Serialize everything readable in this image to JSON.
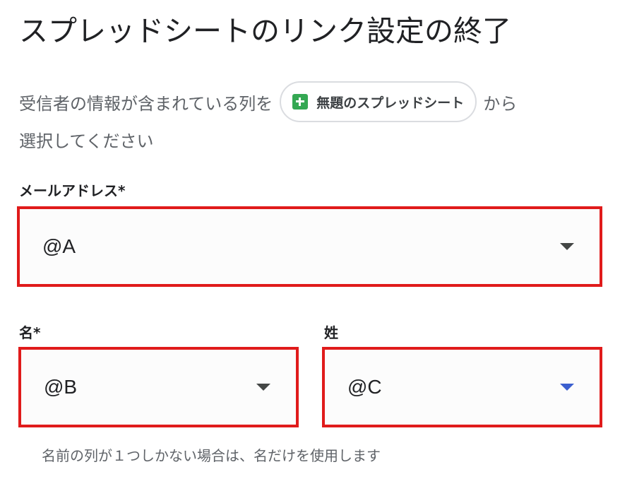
{
  "title": "スプレッドシートのリンク設定の終了",
  "intro": {
    "before_chip": "受信者の情報が含まれている列を",
    "chip_label": "無題のスプレッドシート",
    "chip_icon": "sheets-icon",
    "after_chip": "から",
    "line2": "選択してください"
  },
  "fields": {
    "email": {
      "label": "メールアドレス*",
      "value": "@A"
    },
    "first_name": {
      "label": "名*",
      "value": "@B"
    },
    "last_name": {
      "label": "姓",
      "value": "@C"
    }
  },
  "helper_text": "名前の列が１つしかない場合は、名だけを使用します",
  "colors": {
    "highlight_border": "#e01b1b",
    "sheets_green": "#34a853",
    "active_caret": "#3b5fcf"
  }
}
